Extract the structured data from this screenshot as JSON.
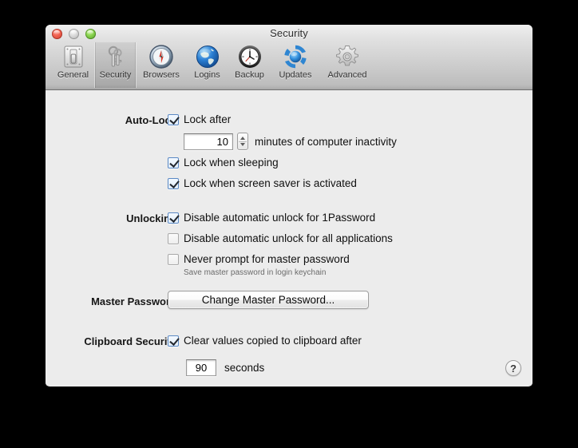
{
  "window": {
    "title": "Security",
    "traffic_lights": [
      {
        "name": "close",
        "color": "#ef5f4e"
      },
      {
        "name": "minimize",
        "color": "#d8d8d8"
      },
      {
        "name": "zoom",
        "color": "#86d14c"
      }
    ]
  },
  "toolbar": {
    "selected": "Security",
    "items": [
      {
        "label": "General",
        "icon": "switch-icon"
      },
      {
        "label": "Security",
        "icon": "keys-icon"
      },
      {
        "label": "Browsers",
        "icon": "compass-icon"
      },
      {
        "label": "Logins",
        "icon": "globe-icon"
      },
      {
        "label": "Backup",
        "icon": "clock-icon"
      },
      {
        "label": "Updates",
        "icon": "refresh-icon"
      },
      {
        "label": "Advanced",
        "icon": "gear-icon"
      }
    ]
  },
  "sections": {
    "auto_lock": {
      "label": "Auto-Lock",
      "lock_after": {
        "label": "Lock after",
        "checked": true
      },
      "minutes_value": "10",
      "minutes_suffix": "minutes of computer inactivity",
      "lock_sleeping": {
        "label": "Lock when sleeping",
        "checked": true
      },
      "lock_screensaver": {
        "label": "Lock when screen saver is activated",
        "checked": true
      }
    },
    "unlocking": {
      "label": "Unlocking",
      "disable_1password": {
        "label": "Disable automatic unlock for 1Password",
        "checked": true
      },
      "disable_all_apps": {
        "label": "Disable automatic unlock for all applications",
        "checked": false
      },
      "never_prompt": {
        "label": "Never prompt for master password",
        "checked": false
      },
      "never_prompt_note": "Save master password in login keychain"
    },
    "master_password": {
      "label": "Master Password",
      "button_label": "Change Master Password..."
    },
    "clipboard_security": {
      "label": "Clipboard Security",
      "clear_values": {
        "label": "Clear values copied to clipboard after",
        "checked": true
      },
      "seconds_value": "90",
      "seconds_suffix": "seconds"
    }
  },
  "help_button": {
    "label": "?",
    "icon": "question-mark-icon"
  }
}
